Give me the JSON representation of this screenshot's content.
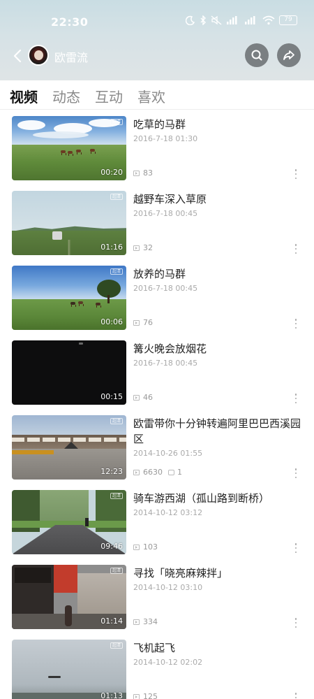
{
  "status_bar": {
    "time": "22:30",
    "battery": "79"
  },
  "header": {
    "channel_name": "欧雷流",
    "icons": [
      "back-arrow-icon",
      "search-icon",
      "share-icon"
    ]
  },
  "tabs": [
    {
      "label": "视频",
      "active": true
    },
    {
      "label": "动态",
      "active": false
    },
    {
      "label": "互动",
      "active": false
    },
    {
      "label": "喜欢",
      "active": false
    }
  ],
  "videos": [
    {
      "title": "吃草的马群",
      "date": "2016-7-18 01:30",
      "duration": "00:20",
      "views": "83",
      "comments": "",
      "badge": "超清"
    },
    {
      "title": "越野车深入草原",
      "date": "2016-7-18 00:45",
      "duration": "01:16",
      "views": "32",
      "comments": "",
      "badge": "超清"
    },
    {
      "title": "放养的马群",
      "date": "2016-7-18 00:45",
      "duration": "00:06",
      "views": "76",
      "comments": "",
      "badge": "超清"
    },
    {
      "title": "篝火晚会放烟花",
      "date": "2016-7-18 00:45",
      "duration": "00:15",
      "views": "46",
      "comments": "",
      "badge": ""
    },
    {
      "title": "欧雷带你十分钟转遍阿里巴巴西溪园区",
      "date": "2014-10-26 01:55",
      "duration": "12:23",
      "views": "6630",
      "comments": "1",
      "badge": "超清"
    },
    {
      "title": "骑车游西湖（孤山路到断桥）",
      "date": "2014-10-12 03:12",
      "duration": "09:46",
      "views": "103",
      "comments": "",
      "badge": "超清"
    },
    {
      "title": "寻找「晓亮麻辣拌」",
      "date": "2014-10-12 03:10",
      "duration": "01:14",
      "views": "334",
      "comments": "",
      "badge": "超清"
    },
    {
      "title": "飞机起飞",
      "date": "2014-10-12 02:02",
      "duration": "01:13",
      "views": "125",
      "comments": "",
      "badge": "超清"
    }
  ]
}
